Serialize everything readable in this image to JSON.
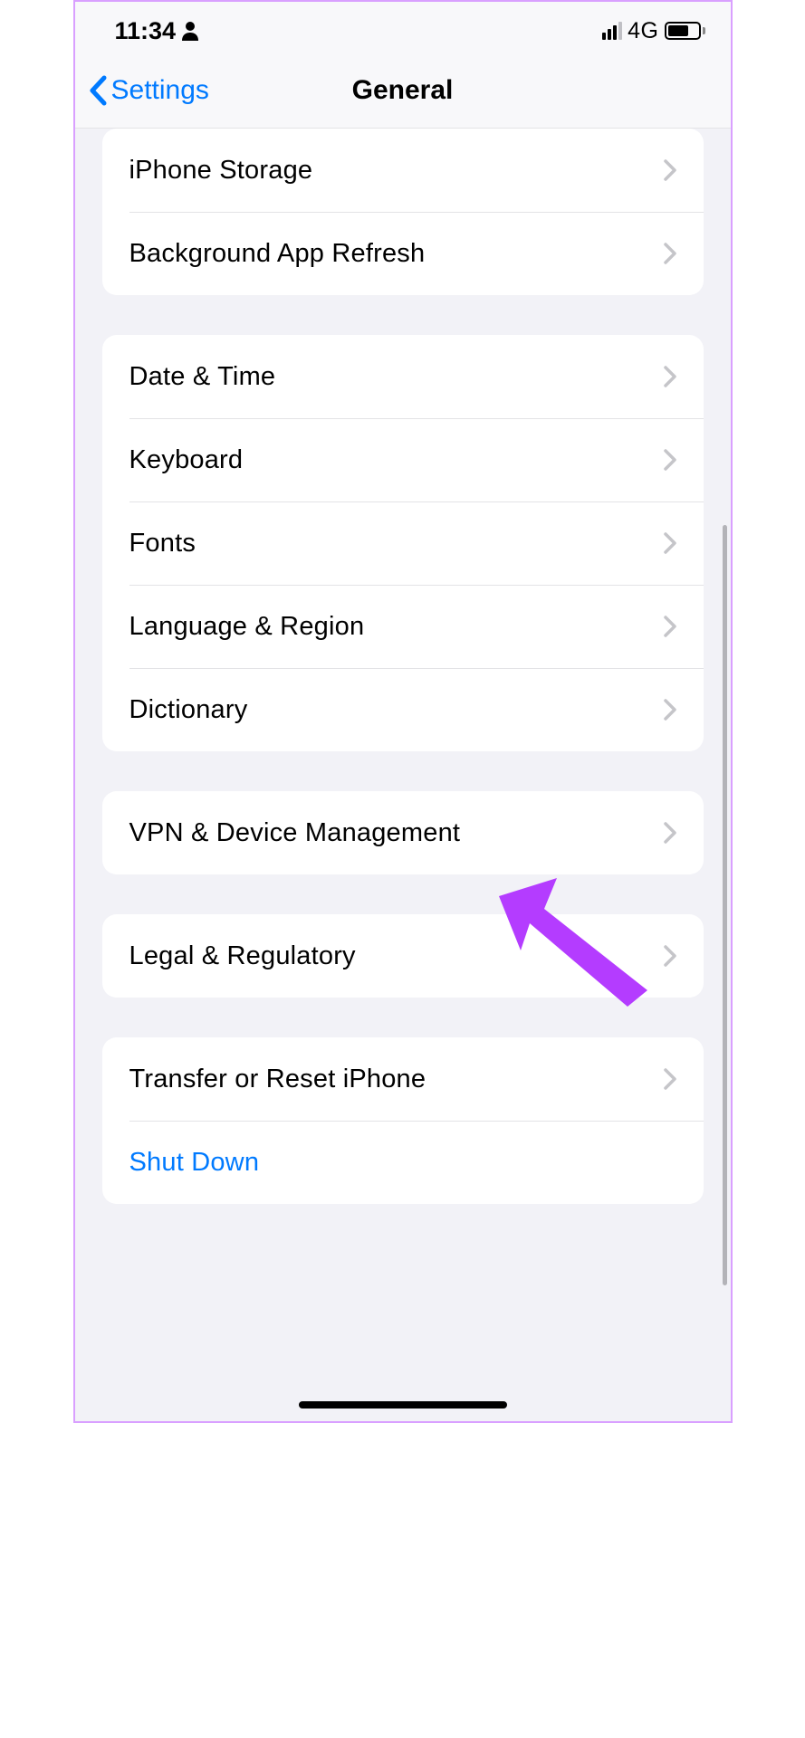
{
  "status": {
    "time": "11:34",
    "network": "4G"
  },
  "nav": {
    "back_label": "Settings",
    "title": "General"
  },
  "groups": [
    {
      "id": "g1",
      "first": true,
      "items": [
        {
          "name": "iphone-storage",
          "label": "iPhone Storage",
          "disclosure": true
        },
        {
          "name": "background-app-refresh",
          "label": "Background App Refresh",
          "disclosure": true
        }
      ]
    },
    {
      "id": "g2",
      "items": [
        {
          "name": "date-time",
          "label": "Date & Time",
          "disclosure": true
        },
        {
          "name": "keyboard",
          "label": "Keyboard",
          "disclosure": true
        },
        {
          "name": "fonts",
          "label": "Fonts",
          "disclosure": true
        },
        {
          "name": "language-region",
          "label": "Language & Region",
          "disclosure": true
        },
        {
          "name": "dictionary",
          "label": "Dictionary",
          "disclosure": true
        }
      ]
    },
    {
      "id": "g3",
      "items": [
        {
          "name": "vpn-device-management",
          "label": "VPN & Device Management",
          "disclosure": true
        }
      ]
    },
    {
      "id": "g4",
      "items": [
        {
          "name": "legal-regulatory",
          "label": "Legal & Regulatory",
          "disclosure": true
        }
      ]
    },
    {
      "id": "g5",
      "items": [
        {
          "name": "transfer-reset-iphone",
          "label": "Transfer or Reset iPhone",
          "disclosure": true
        },
        {
          "name": "shut-down",
          "label": "Shut Down",
          "disclosure": false,
          "link": true
        }
      ]
    }
  ],
  "annotation": {
    "color": "#b43cff"
  }
}
